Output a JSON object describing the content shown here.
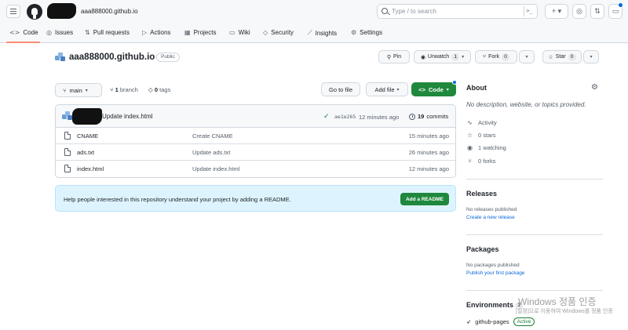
{
  "header": {
    "repo_crumb": "aaa888000.github.io",
    "search_placeholder": "Type / to search",
    "command_glyph": ">_",
    "plus_label": "+ ▾",
    "icons": [
      "hamburger-icon",
      "github-logo-icon",
      "search-icon",
      "command-palette-icon",
      "plus-icon",
      "issues-icon",
      "pull-requests-icon",
      "inbox-icon"
    ]
  },
  "tabs": [
    {
      "label": "Code",
      "icon": "code-icon",
      "glyph": "<>"
    },
    {
      "label": "Issues",
      "icon": "issue-icon",
      "glyph": "◎"
    },
    {
      "label": "Pull requests",
      "icon": "pull-request-icon",
      "glyph": "⇅"
    },
    {
      "label": "Actions",
      "icon": "play-icon",
      "glyph": "▷"
    },
    {
      "label": "Projects",
      "icon": "table-icon",
      "glyph": "▦"
    },
    {
      "label": "Wiki",
      "icon": "book-icon",
      "glyph": "▭"
    },
    {
      "label": "Security",
      "icon": "shield-icon",
      "glyph": "◇"
    },
    {
      "label": "Insights",
      "icon": "graph-icon",
      "glyph": "⟋"
    },
    {
      "label": "Settings",
      "icon": "gear-icon",
      "glyph": "⚙"
    }
  ],
  "repo": {
    "name": "aaa888000.github.io",
    "visibility": "Public",
    "pin_label": "Pin",
    "watch_label": "Unwatch",
    "watch_count": "1",
    "fork_label": "Fork",
    "fork_count": "0",
    "star_label": "Star",
    "star_count": "0"
  },
  "branch_bar": {
    "branch": "main",
    "branches_count": "1",
    "branches_label": "branch",
    "tags_count": "0",
    "tags_label": "tags",
    "go_to_file": "Go to file",
    "add_file": "Add file",
    "code_label": "Code"
  },
  "latest_commit": {
    "message": "Update index.html",
    "sha": "ae1e265",
    "time": "12 minutes ago",
    "commits_count": "19",
    "commits_label": "commits"
  },
  "files": [
    {
      "name": "CNAME",
      "commit": "Create CNAME",
      "time": "15 minutes ago"
    },
    {
      "name": "ads.txt",
      "commit": "Update ads.txt",
      "time": "26 minutes ago"
    },
    {
      "name": "index.html",
      "commit": "Update index.html",
      "time": "12 minutes ago"
    }
  ],
  "readme_banner": {
    "text": "Help people interested in this repository understand your project by adding a README.",
    "button": "Add a README"
  },
  "sidebar": {
    "about_title": "About",
    "about_desc": "No description, website, or topics provided.",
    "stats": [
      {
        "label": "Activity",
        "icon": "pulse-icon",
        "glyph": "∿"
      },
      {
        "label": "0 stars",
        "icon": "star-icon",
        "glyph": "☆"
      },
      {
        "label": "1 watching",
        "icon": "eye-icon",
        "glyph": "◉"
      },
      {
        "label": "0 forks",
        "icon": "fork-icon",
        "glyph": "⑂"
      }
    ],
    "releases_title": "Releases",
    "releases_empty": "No releases published",
    "releases_link": "Create a new release",
    "packages_title": "Packages",
    "packages_empty": "No packages published",
    "packages_link": "Publish your first package",
    "environments_title": "Environments",
    "environments_count": "1",
    "environment_name": "github-pages",
    "environment_status": "Active"
  },
  "watermark": {
    "line1": "Windows 정품 인증",
    "line2": "[설정]으로 이동하여 Windows를 정품 인증"
  },
  "colors": {
    "accent_green": "#1f883d",
    "link_blue": "#0969da",
    "tab_underline": "#fd8c73",
    "banner_bg": "#ddf4ff"
  }
}
